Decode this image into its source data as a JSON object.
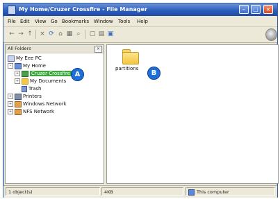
{
  "window": {
    "title": "My Home/Cruzer Crossfire - File Manager",
    "min": "–",
    "max": "□",
    "close": "×"
  },
  "menu": {
    "items": [
      "File",
      "Edit",
      "View",
      "Go",
      "Bookmarks",
      "Window",
      "Tools",
      "Help"
    ]
  },
  "toolbar": {
    "back_icon": "←",
    "forward_icon": "→",
    "up_icon": "↑",
    "stop_icon": "×",
    "reload_icon": "⟳",
    "home_icon": "⌂",
    "print_icon": "▦",
    "find_icon": "⌕",
    "view_icon": "▢",
    "props_icon": "▤",
    "extra_icon": "▣"
  },
  "sidebar": {
    "title": "All Folders",
    "close": "×",
    "items": [
      {
        "label": "My Eee PC"
      },
      {
        "label": "My Home"
      },
      {
        "label": "Cruzer Crossfire"
      },
      {
        "label": "My Documents"
      },
      {
        "label": "Trash"
      },
      {
        "label": "Printers"
      },
      {
        "label": "Windows Network"
      },
      {
        "label": "NFS Network"
      }
    ],
    "expanders": {
      "my_home": "–",
      "cruzer": "+",
      "my_docs": "+",
      "printers": "+",
      "windows": "+",
      "nfs": "+"
    }
  },
  "main": {
    "items": [
      {
        "label": "partitions"
      }
    ]
  },
  "callouts": {
    "a": "A",
    "b": "B"
  },
  "status": {
    "objects": "1 object(s)",
    "size": "4KB",
    "zone": "This computer"
  },
  "colors": {
    "title_bar": "#2e5fbf",
    "selection": "#3ca63c",
    "badge": "#1e6fd8"
  }
}
